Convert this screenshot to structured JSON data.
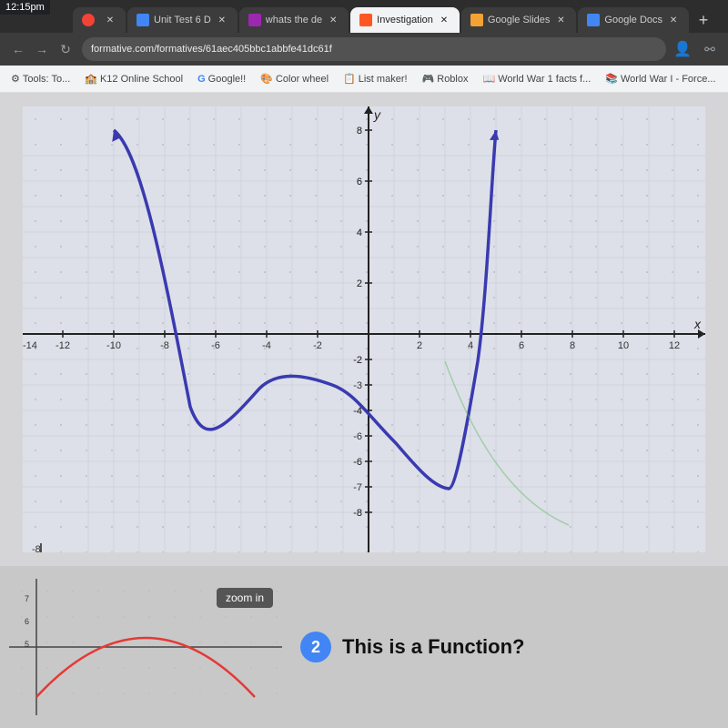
{
  "browser": {
    "time": "12:15pm",
    "tabs": [
      {
        "id": "tab1",
        "label": "",
        "favicon_color": "#f44336",
        "active": false
      },
      {
        "id": "tab2",
        "label": "Unit Test 6 D",
        "favicon_color": "#4285f4",
        "active": false
      },
      {
        "id": "tab3",
        "label": "whats the de",
        "favicon_color": "#9c27b0",
        "active": false
      },
      {
        "id": "tab4",
        "label": "Investigation",
        "favicon_color": "#ff5722",
        "active": true
      },
      {
        "id": "tab5",
        "label": "Google Slides",
        "favicon_color": "#f4a234",
        "active": false
      },
      {
        "id": "tab6",
        "label": "Google Docs",
        "favicon_color": "#4285f4",
        "active": false
      }
    ],
    "address": "formative.com/formatives/61aec405bbc1abbfe41dc61f",
    "bookmarks": [
      {
        "label": "Tools: To...",
        "favicon": "⚙"
      },
      {
        "label": "K12 Online School",
        "favicon": "🏫"
      },
      {
        "label": "Google!!",
        "favicon": "G"
      },
      {
        "label": "Color wheel",
        "favicon": "🎨"
      },
      {
        "label": "List maker!",
        "favicon": "📋"
      },
      {
        "label": "Roblox",
        "favicon": "🎮"
      },
      {
        "label": "World War 1 facts f...",
        "favicon": "📖"
      },
      {
        "label": "World War I - Force...",
        "favicon": "📚"
      }
    ]
  },
  "graph": {
    "x_labels": [
      "-14",
      "-12",
      "-10",
      "-8",
      "-6",
      "-4",
      "-2",
      "",
      "2",
      "4",
      "6",
      "8",
      "10",
      "12"
    ],
    "y_labels": [
      "8",
      "6",
      "4",
      "2",
      "-2",
      "-4",
      "-6",
      "-8"
    ],
    "x_axis_label": "x",
    "y_axis_label": "y"
  },
  "bottom": {
    "zoom_in_label": "zoom in",
    "question_number": "2",
    "question_text": "This is a Function?",
    "mini_y_labels": [
      "7",
      "6",
      "5"
    ]
  }
}
